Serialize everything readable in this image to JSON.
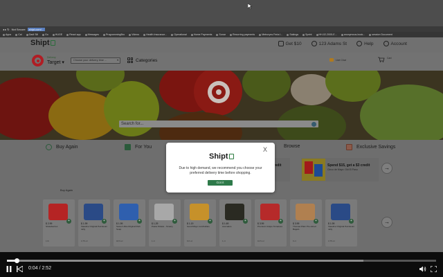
{
  "browser": {
    "security": "Not Secure",
    "url": "shipt.com/...",
    "bookmarks": [
      "Apps",
      "Cal",
      "Gadi Sill",
      "Go",
      "HUGE",
      "React app",
      "Messages",
      "ProgrammingBro",
      "Videos",
      "Health Insurance...",
      "Operational",
      "Home Payments",
      "Sonar",
      "Recurring payments",
      "Metroryns Feria I...",
      "Sakings",
      "Sprint",
      "HH-02-2005-E...",
      "anonymous-book...",
      "session Document"
    ]
  },
  "header": {
    "brand": "Shipt",
    "get_credit": "Get $10",
    "address": "123 Adams St",
    "help": "Help",
    "account": "Account"
  },
  "store": {
    "label": "Delivery",
    "name": "Target",
    "delivery_placeholder": "Choose your delivery time ...",
    "categories": "Categories",
    "live_chat": "Live Chat",
    "cart": "Cart"
  },
  "search": {
    "placeholder": "Search for..."
  },
  "nav": {
    "buy_again": "Buy Again",
    "for_you": "For You",
    "browse": "Browse",
    "exclusive_savings": "Exclusive Savings"
  },
  "promos": [
    {
      "title": "Spend $15, get a $3 credit",
      "subtitle": "Cinco de Mayo: Old El Paso"
    },
    {
      "title": "Spend $15, get a $3 credit",
      "subtitle": "Cinco de Mayo: Old El Paso"
    }
  ],
  "section": {
    "title": "Buy Again"
  },
  "products": [
    {
      "price": "$ 2.99",
      "name": "Strawberries",
      "size": "1 lb",
      "color": "#b52424"
    },
    {
      "price": "$ 1.99",
      "name": "Vaseline Original Petroleum Jelly",
      "size": "3.75 oz",
      "color": "#2a4a86"
    },
    {
      "price": "$ 1.99",
      "name": "Sweet Ultra-Original Dish Soap",
      "size": "18 fl oz",
      "color": "#2f5fae"
    },
    {
      "price": "$ 1.29",
      "name": "Pasta Straws - Smarty",
      "size": "1 ct",
      "color": "#a8a8a8"
    },
    {
      "price": "$ 1.19",
      "name": "Good Mayo Lunchables",
      "size": "9.6 oz",
      "color": "#c6912a"
    },
    {
      "price": "$ 1.69",
      "name": "Avocados",
      "size": "1 ct",
      "color": "#2a2a22"
    },
    {
      "price": "$ 3.99",
      "name": "Premium Grape Tomatoes",
      "size": "10.5 oz",
      "color": "#b62a2a"
    },
    {
      "price": "$ 3.99",
      "name": "Thomas Plain Pre-sliced Bagels",
      "size": "6 ct",
      "color": "#b08050"
    },
    {
      "price": "$ 1.99",
      "name": "Vaseline Original Petroleum Jelly",
      "size": "3.75 oz",
      "color": "#2a4a86"
    }
  ],
  "modal": {
    "brand": "Shipt",
    "close": "X",
    "message": "Due to high demand, we recommend you choose your preferred delivery time before shopping.",
    "button": "Got it"
  },
  "video": {
    "current_time": "0:04",
    "duration": "2:52",
    "time_display": "0:04 / 2:52",
    "progress": 0.023,
    "buffered": 0.83
  },
  "colors": {
    "shipt_green": "#2e7a4a",
    "target_red": "#b01d24"
  }
}
